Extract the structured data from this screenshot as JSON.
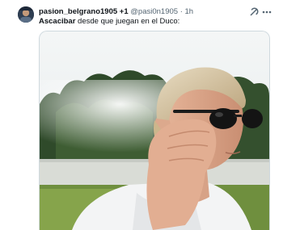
{
  "post": {
    "display_name": "pasion_belgrano1905",
    "plus": "+1",
    "handle": "@pasi0n1905",
    "separator": "·",
    "time": "1h",
    "text_bold": "Ascacibar",
    "text_rest": " desde que juegan en el Duco:"
  },
  "icons": {
    "grok": "grok-icon",
    "more": "more-icon"
  },
  "media": {
    "description_icon": "photo"
  }
}
